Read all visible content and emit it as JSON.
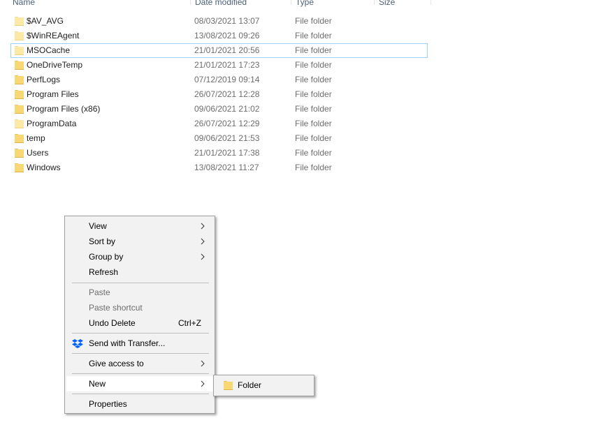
{
  "columns": [
    "Name",
    "Date modified",
    "Type",
    "Size"
  ],
  "files": [
    {
      "name": "$AV_AVG",
      "date": "08/03/2021 13:07",
      "type": "File folder",
      "faint": true
    },
    {
      "name": "$WinREAgent",
      "date": "13/08/2021 09:26",
      "type": "File folder",
      "faint": true
    },
    {
      "name": "MSOCache",
      "date": "21/01/2021 20:56",
      "type": "File folder",
      "faint": true,
      "focused": true
    },
    {
      "name": "OneDriveTemp",
      "date": "21/01/2021 17:23",
      "type": "File folder",
      "faint": false
    },
    {
      "name": "PerfLogs",
      "date": "07/12/2019 09:14",
      "type": "File folder",
      "faint": false
    },
    {
      "name": "Program Files",
      "date": "26/07/2021 12:28",
      "type": "File folder",
      "faint": false
    },
    {
      "name": "Program Files (x86)",
      "date": "09/06/2021 21:02",
      "type": "File folder",
      "faint": false
    },
    {
      "name": "ProgramData",
      "date": "26/07/2021 12:29",
      "type": "File folder",
      "faint": true
    },
    {
      "name": "temp",
      "date": "09/06/2021 21:53",
      "type": "File folder",
      "faint": false
    },
    {
      "name": "Users",
      "date": "21/01/2021 17:38",
      "type": "File folder",
      "faint": false
    },
    {
      "name": "Windows",
      "date": "13/08/2021 11:27",
      "type": "File folder",
      "faint": false
    }
  ],
  "context_menu": {
    "view": "View",
    "sort_by": "Sort by",
    "group_by": "Group by",
    "refresh": "Refresh",
    "paste": "Paste",
    "paste_shortcut": "Paste shortcut",
    "undo_delete": "Undo Delete",
    "undo_delete_shortcut": "Ctrl+Z",
    "send_with_transfer": "Send with Transfer...",
    "give_access_to": "Give access to",
    "new": "New",
    "properties": "Properties"
  },
  "submenu": {
    "folder": "Folder"
  },
  "icons": {
    "folder": "folder-icon",
    "dropbox": "dropbox-icon",
    "submenu_arrow": "chevron-right-icon"
  },
  "colors": {
    "folder": "#f8d775",
    "dropbox": "#0061fe",
    "focus_border": "#99d1ff",
    "header_text": "#4c607a"
  }
}
